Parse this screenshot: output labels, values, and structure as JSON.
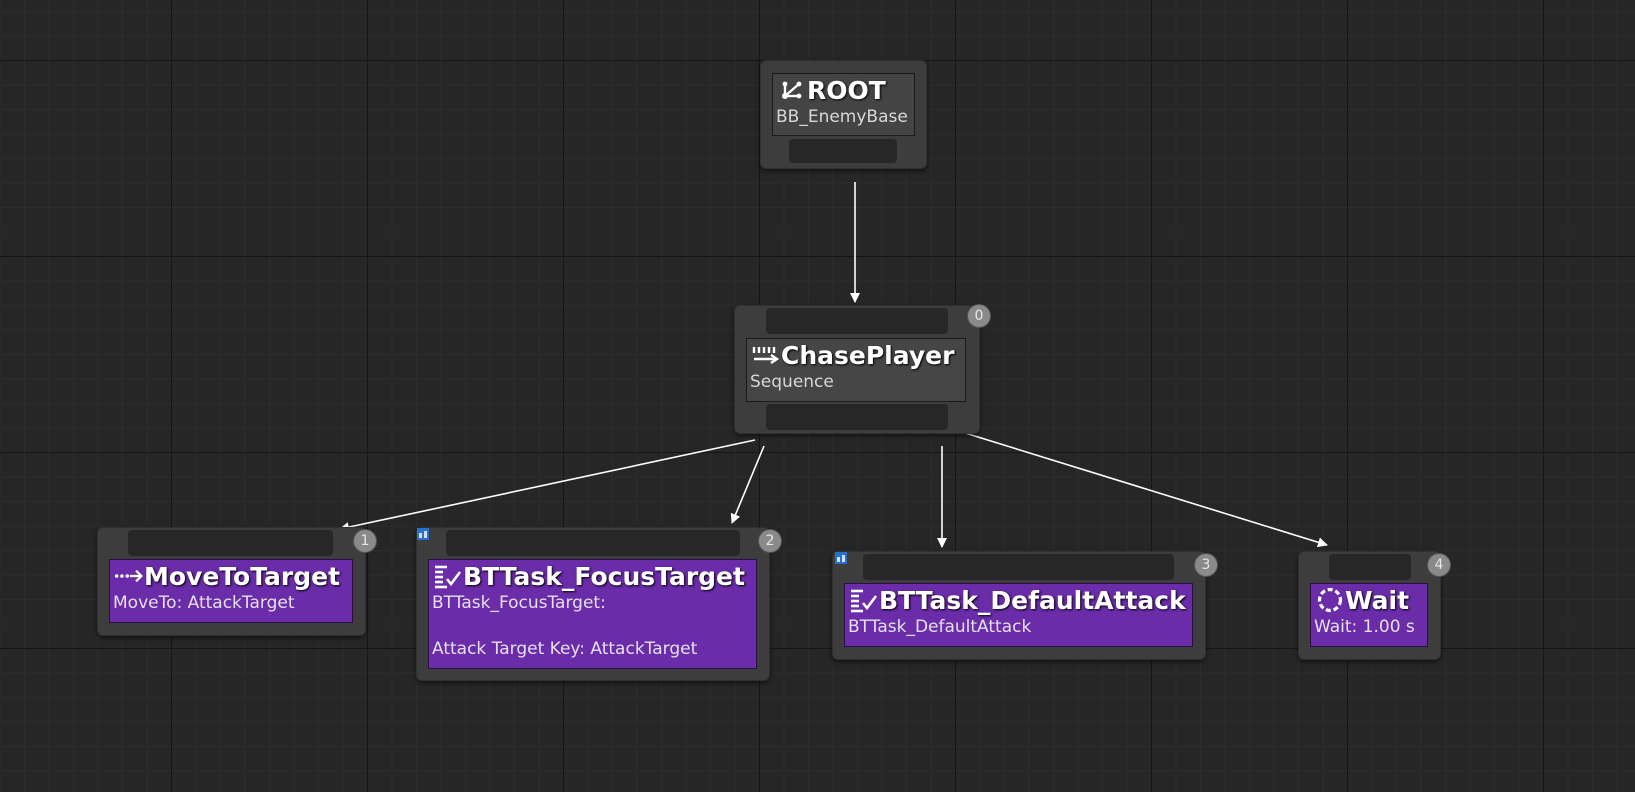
{
  "nodes": {
    "root": {
      "title": "ROOT",
      "subtitle": "BB_EnemyBase",
      "icon": "root-branch-icon"
    },
    "chase": {
      "title": "ChasePlayer",
      "subtitle": "Sequence",
      "index": "0",
      "icon": "sequence-icon"
    },
    "move": {
      "title": "MoveToTarget",
      "subtitle": "MoveTo: AttackTarget",
      "index": "1",
      "icon": "move-to-icon"
    },
    "focus": {
      "title": "BTTask_FocusTarget",
      "subtitle": "BTTask_FocusTarget:",
      "detail": "Attack Target Key: AttackTarget",
      "index": "2",
      "icon": "task-icon"
    },
    "attack": {
      "title": "BTTask_DefaultAttack",
      "subtitle": "BTTask_DefaultAttack",
      "index": "3",
      "icon": "task-icon"
    },
    "wait": {
      "title": "Wait",
      "subtitle": "Wait: 1.00 s",
      "index": "4",
      "icon": "wait-icon"
    }
  },
  "colors": {
    "task": "#6a2ca8",
    "node": "#3d3d3d",
    "wire": "#ffffff",
    "background": "#262626"
  }
}
